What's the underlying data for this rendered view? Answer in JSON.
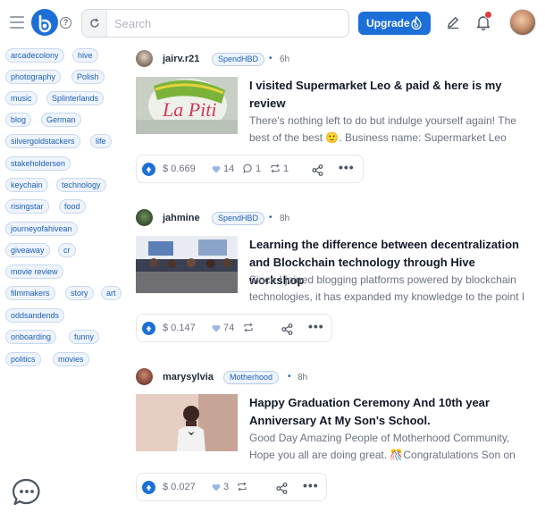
{
  "header": {
    "search_placeholder": "Search",
    "upgrade_label": "Upgrade",
    "icons": [
      "menu-icon",
      "logo",
      "help-icon",
      "refresh-icon",
      "fire-icon",
      "pencil-icon",
      "bell-icon"
    ],
    "accent_color": "#1d6fd8"
  },
  "sidebar": {
    "tags": [
      "arcadecolony",
      "hive",
      "photography",
      "Polish",
      "music",
      "Splinterlands",
      "blog",
      "German",
      "silvergoldstackers",
      "life",
      "stakeholdersen",
      "keychain",
      "technology",
      "risingstar",
      "food",
      "journeyofahivean",
      "giveaway",
      "cr",
      "movie review",
      "filmmakers",
      "story",
      "art",
      "oddsandends",
      "onboarding",
      "funny",
      "politics",
      "movies"
    ]
  },
  "posts": [
    {
      "author": "jairv.r21",
      "community": "SpendHBD",
      "dot": "•",
      "time": "6h",
      "title": "I visited Supermarket Leo & paid & here is my review",
      "body": "There's nothing left to do but indulge yourself again! The best of the best 🙂. Business name: Supermarket Leo Open",
      "payout": "$ 0.669",
      "votes": "14",
      "comments": "1",
      "reblogs": "1"
    },
    {
      "author": "jahmine",
      "community": "SpendHBD",
      "dot": "•",
      "time": "8h",
      "title": "Learning the difference between decentralization and Blockchain technology through Hive workshop",
      "body": "Since I joined blogging platforms powered by blockchain technologies, it has expanded my knowledge to the point I",
      "payout": "$ 0.147",
      "votes": "74",
      "comments": "",
      "reblogs": ""
    },
    {
      "author": "marysylvia",
      "community": "Motherhood",
      "dot": "•",
      "time": "8h",
      "title": "Happy Graduation Ceremony And 10th year Anniversary At My Son's School.",
      "body": "Good Day Amazing People of Motherhood Community, Hope you all are doing great. 🎊Congratulations Son on",
      "payout": "$ 0.027",
      "votes": "3",
      "comments": "",
      "reblogs": ""
    }
  ],
  "more_label": "•••"
}
